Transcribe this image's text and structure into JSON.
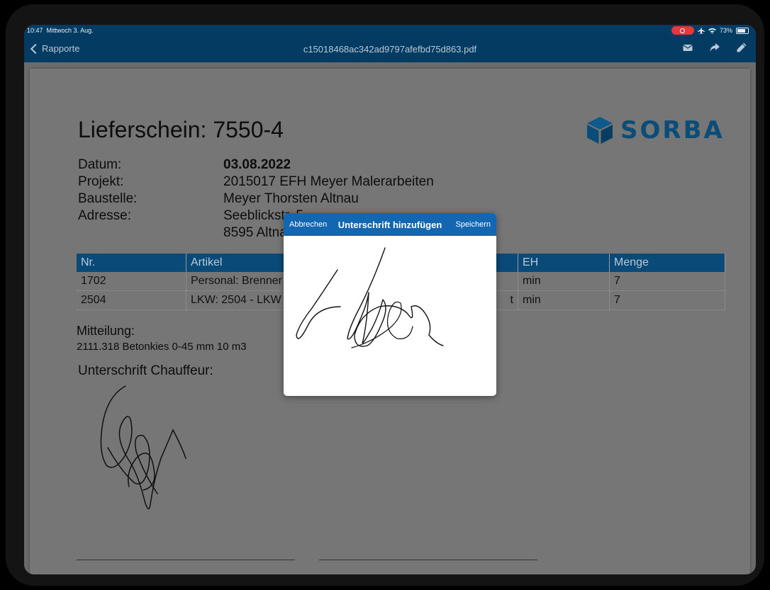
{
  "status": {
    "time": "10:47",
    "date": "Mittwoch 3. Aug.",
    "battery": "73%"
  },
  "nav": {
    "back_label": "Rapporte",
    "title": "c15018468ac342ad9797afefbd75d863.pdf"
  },
  "document": {
    "heading": "Lieferschein: 7550-4",
    "logo": "SORBA",
    "fields": {
      "datum_label": "Datum:",
      "datum_value": "03.08.2022",
      "projekt_label": "Projekt:",
      "projekt_value": "2015017 EFH Meyer Malerarbeiten",
      "baustelle_label": "Baustelle:",
      "baustelle_value": "Meyer Thorsten Altnau",
      "adresse_label": "Adresse:",
      "adresse_line1": "Seeblickstr. 5",
      "adresse_line2": "8595 Altnau"
    },
    "table": {
      "headers": [
        "Nr.",
        "Artikel",
        "",
        "EH",
        "Menge"
      ],
      "rows": [
        [
          "1702",
          "Personal: Brenner",
          "",
          "min",
          "7"
        ],
        [
          "2504",
          "LKW: 2504 - LKW",
          "t",
          "min",
          "7"
        ]
      ]
    },
    "mitteilung_label": "Mitteilung:",
    "mitteilung_text": "2111.318 Betonkies 0-45 mm 10 m3",
    "signature_label": "Unterschrift Chauffeur:"
  },
  "dialog": {
    "cancel_label": "Abbrechen",
    "title": "Unterschrift hinzufügen",
    "save_label": "Speichern"
  },
  "colors": {
    "nav_bg": "#043b63",
    "table_header": "#0a4a78",
    "dialog_header": "#1366b0",
    "logo": "#0b4d79"
  },
  "icons": [
    "chevron-left-icon",
    "mail-icon",
    "share-icon",
    "pencil-icon",
    "airplane-icon",
    "wifi-icon",
    "battery-icon",
    "record-icon",
    "cube-logo-icon"
  ]
}
